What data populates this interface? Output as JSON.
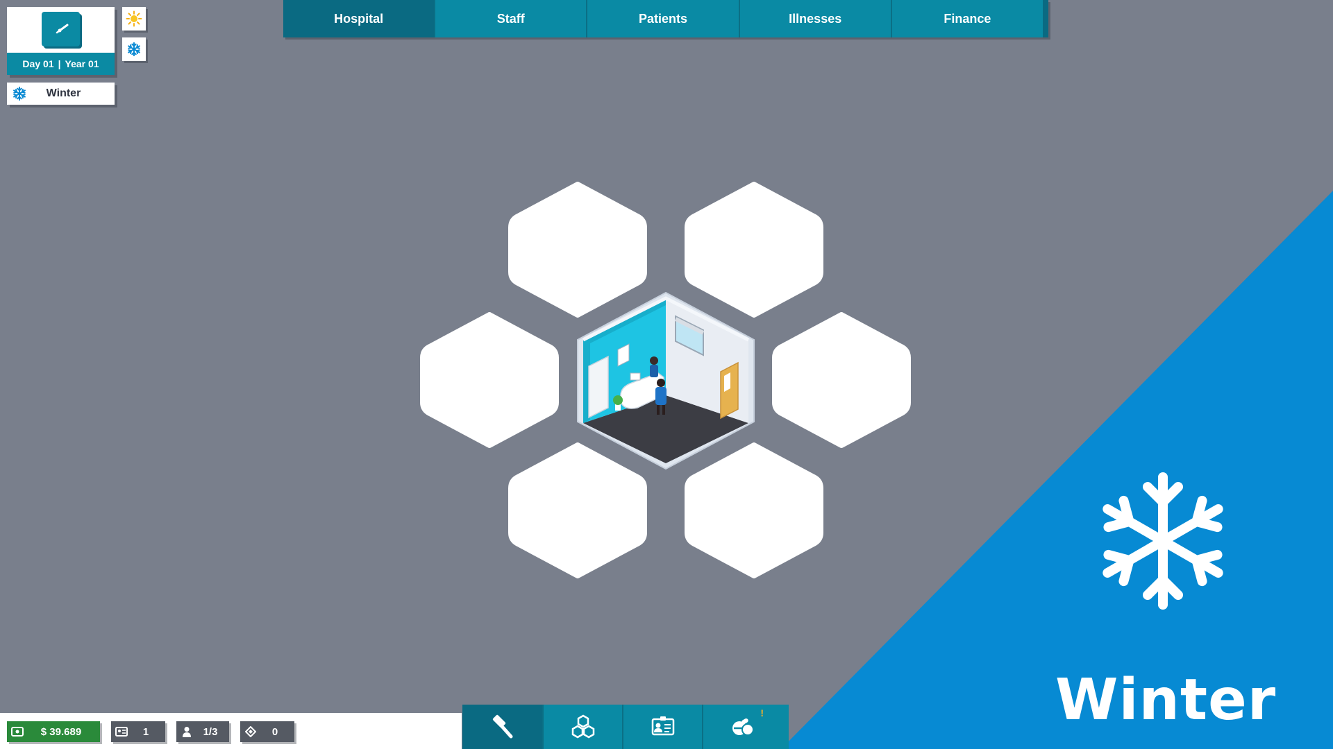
{
  "top_nav": {
    "tabs": [
      {
        "label": "Hospital",
        "active": true
      },
      {
        "label": "Staff",
        "active": false
      },
      {
        "label": "Patients",
        "active": false
      },
      {
        "label": "Illnesses",
        "active": false
      },
      {
        "label": "Finance",
        "active": false
      }
    ]
  },
  "date_card": {
    "icon": "clock-icon",
    "day": "Day 01",
    "separator": "|",
    "year": "Year 01"
  },
  "weather_buttons": [
    {
      "icon": "sun-icon"
    },
    {
      "icon": "snowflake-icon"
    }
  ],
  "season_chip": {
    "icon": "snowflake-icon",
    "label": "Winter"
  },
  "hex_grid": {
    "center_room": "reception-room",
    "empty_slots": 6
  },
  "season_banner": {
    "icon": "snowflake-icon",
    "title": "Winter",
    "color": "#078ad3"
  },
  "status_bar": {
    "money": {
      "icon": "cash-icon",
      "value": "$ 39.689"
    },
    "staff": {
      "icon": "id-card-icon",
      "value": "1"
    },
    "patients": {
      "icon": "person-icon",
      "value": "1/3"
    },
    "items": {
      "icon": "diamond-icon",
      "value": "0"
    }
  },
  "toolbar": {
    "tools": [
      {
        "icon": "hammer-icon"
      },
      {
        "icon": "hex-cluster-icon"
      },
      {
        "icon": "staff-card-icon"
      },
      {
        "icon": "pills-icon",
        "badge": "!"
      }
    ]
  },
  "colors": {
    "background": "#797f8c",
    "accent": "#0a8aa4",
    "accent_dark": "#0a6a82",
    "money_green": "#2a8a3a",
    "winter_blue": "#078ad3"
  }
}
